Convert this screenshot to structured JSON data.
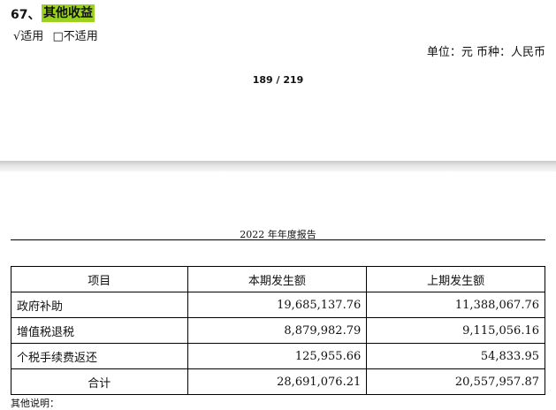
{
  "section": {
    "number": "67、",
    "title": "其他收益"
  },
  "applicability": {
    "applicable": "√适用",
    "not_applicable": "□不适用"
  },
  "unit_line": "单位：元  币种：人民币",
  "page_number": "189 / 219",
  "report_header": "2022 年年度报告",
  "table": {
    "headers": [
      "项目",
      "本期发生额",
      "上期发生额"
    ],
    "rows": [
      {
        "item": "政府补助",
        "current": "19,685,137.76",
        "previous": "11,388,067.76"
      },
      {
        "item": "增值税退税",
        "current": "8,879,982.79",
        "previous": "9,115,056.16"
      },
      {
        "item": "个税手续费返还",
        "current": "125,955.66",
        "previous": "54,833.95"
      }
    ],
    "total": {
      "item": "合计",
      "current": "28,691,076.21",
      "previous": "20,557,957.87"
    }
  },
  "cut_text": "其他说明："
}
